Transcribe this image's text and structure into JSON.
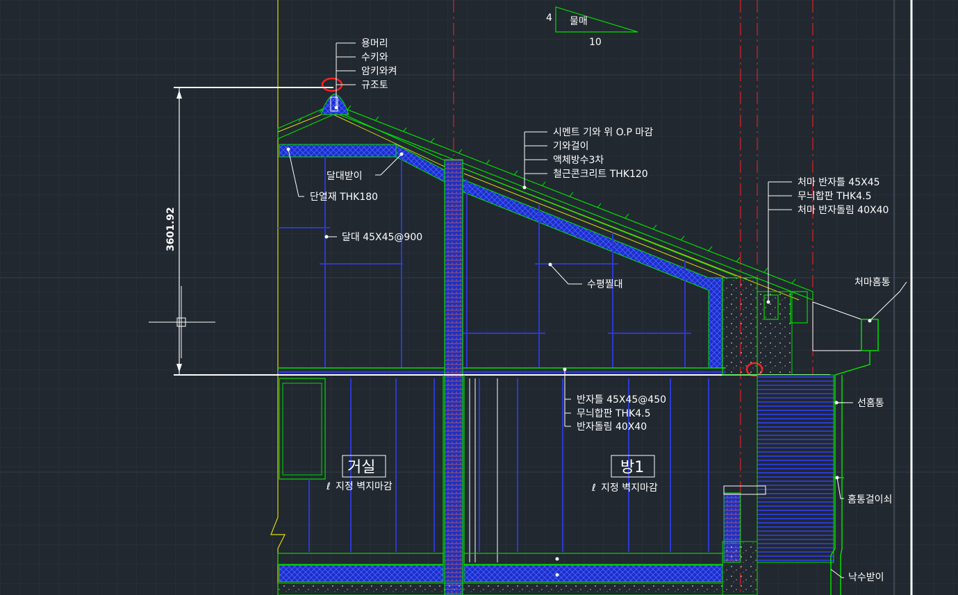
{
  "slope": {
    "rise": "4",
    "run": "10",
    "label": "물매"
  },
  "ridge_labels": [
    "용머리",
    "수키와",
    "암키와켜",
    "규조토"
  ],
  "roof_labels": [
    "시멘트 기와 위 O.P 마감",
    "기와걸이",
    "액체방수3차",
    "철근콘크리트 THK120"
  ],
  "eave_labels": [
    "처마 반자틀 45X45",
    "무늬합판 THK4.5",
    "처마 반자돌림 40X40"
  ],
  "ceiling_labels": [
    "반자틀 45X45@450",
    "무늬합판 THK4.5",
    "반자돌림 40X40"
  ],
  "callouts": {
    "joist_support": "달대받이",
    "insulation": "단열재 THK180",
    "hanger": "달대 45X45@900",
    "horizontal_brace": "수평찔대",
    "eave_gutter": "처마홈통",
    "downpipe": "선홈통",
    "pipe_bracket": "홈통걸이쇠",
    "splash_block": "낙수받이"
  },
  "rooms": [
    {
      "name": "거실",
      "finish": "지정 벽지마감"
    },
    {
      "name": "방1",
      "finish": "지정 벽지마감"
    }
  ],
  "dimension": {
    "height": "3601.92"
  },
  "colors": {
    "background": "#212830",
    "grid": "#2c3540",
    "structure": "#00dd00",
    "insulation": "#2233cc",
    "wall_line": "#dddd00",
    "centerline": "#dd2222",
    "annotation": "#ffffff",
    "highlight_circle": "#ff2020"
  }
}
